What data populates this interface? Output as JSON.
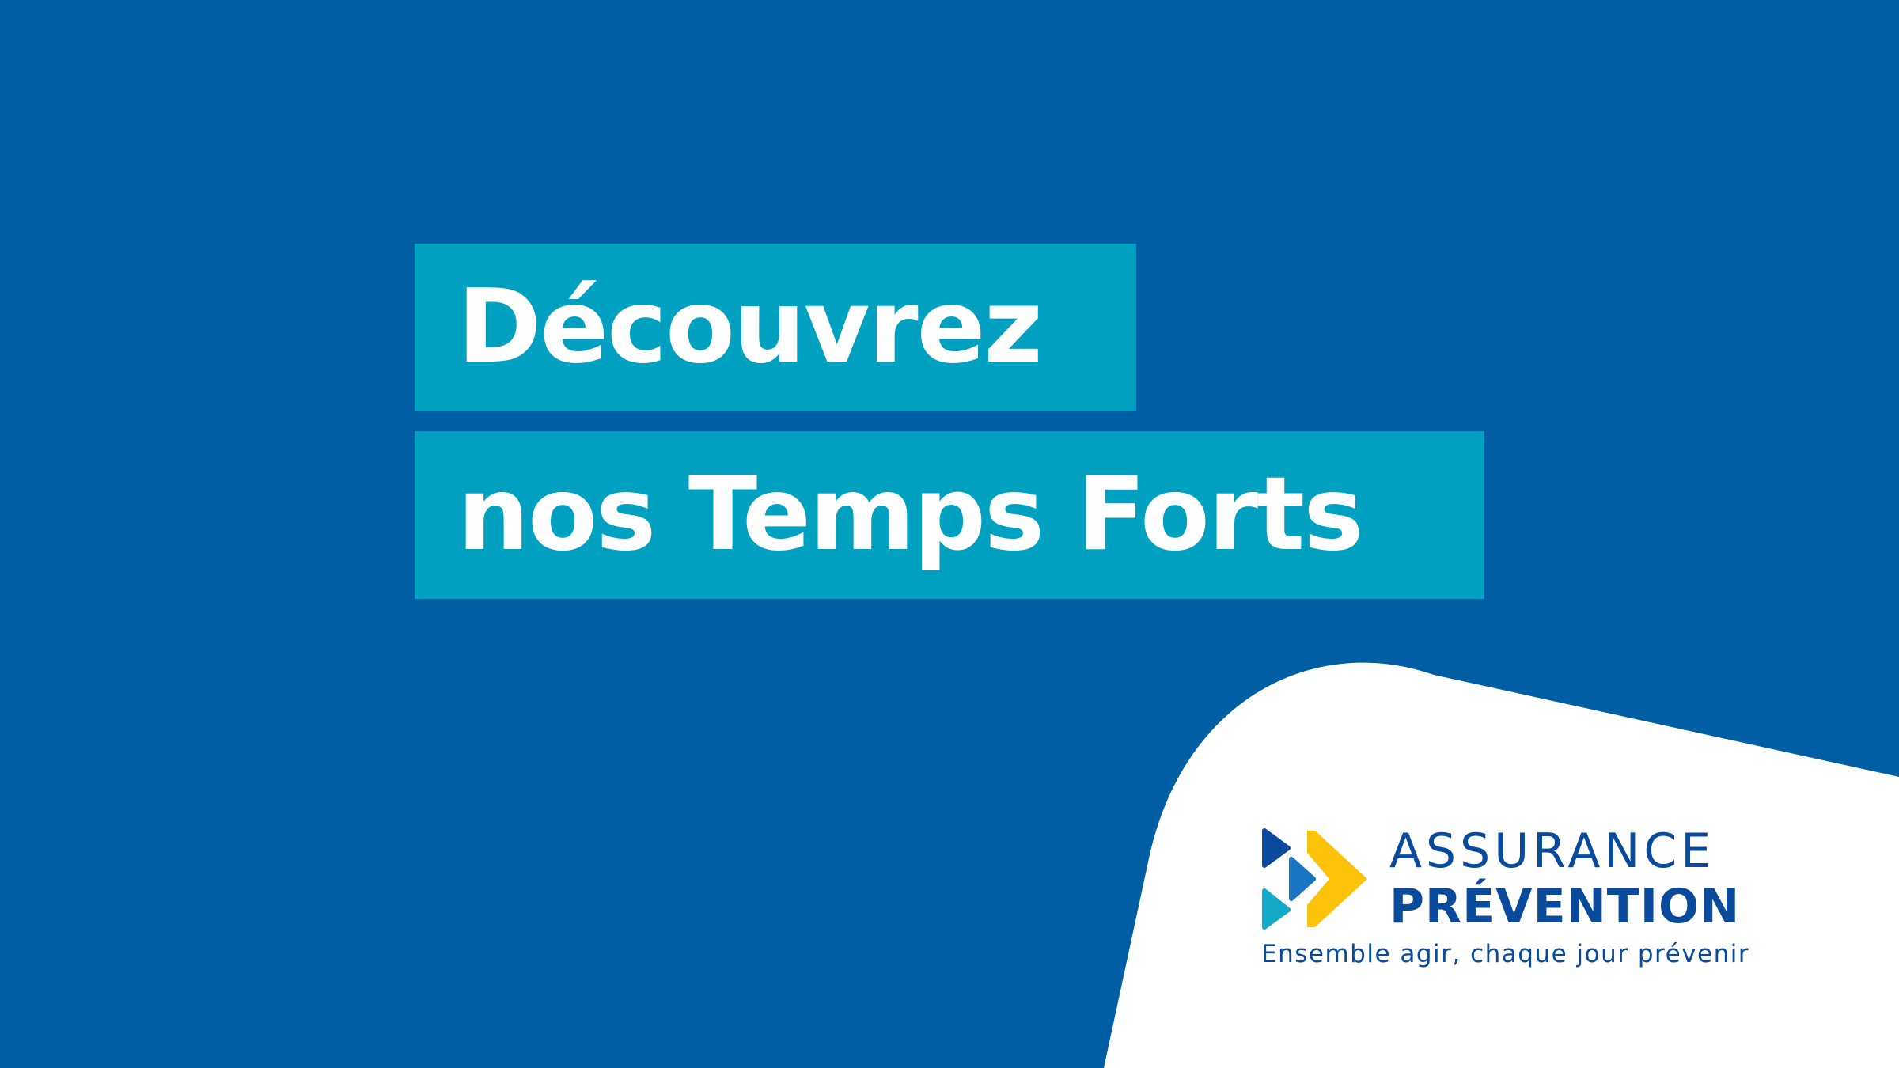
{
  "colors": {
    "background": "#005ea5",
    "headline_box": "#00a1c0",
    "headline_text": "#ffffff",
    "swoosh": "#ffffff",
    "logo_text": "#0a4a9c",
    "logo_navy": "#0a4a9c",
    "logo_blue": "#1a74c4",
    "logo_teal": "#14a9c7",
    "logo_yellow": "#fcc30a"
  },
  "headline": {
    "line1": "Découvrez",
    "line2": "nos Temps Forts"
  },
  "logo": {
    "icon": "assurance-prevention-logo-mark",
    "word1": "ASSURANCE",
    "word2": "PRÉVENTION",
    "tagline": "Ensemble agir, chaque jour prévenir"
  }
}
